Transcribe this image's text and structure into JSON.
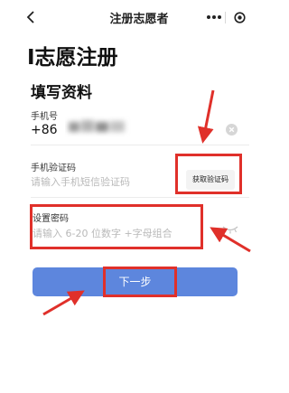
{
  "nav": {
    "title": "注册志愿者",
    "back_icon": "chevron-left-icon",
    "more_icon": "more-dots-icon",
    "close_icon": "target-circle-icon"
  },
  "main": {
    "title": "I志愿注册",
    "section_title": "填写资料"
  },
  "phone": {
    "label": "手机号",
    "prefix": "+86",
    "value_state": "blurred",
    "clear_icon": "clear-circle-icon"
  },
  "sms_code": {
    "label": "手机验证码",
    "placeholder": "请输入手机短信验证码",
    "button_label": "获取验证码"
  },
  "password": {
    "label": "设置密码",
    "placeholder": "请输入 6-20 位数字 +字母组合",
    "visibility_icon": "eye-closed-icon"
  },
  "next_button": {
    "label": "下一步"
  },
  "colors": {
    "primary_button": "#5d86dd",
    "annotation_red": "#e0302a",
    "placeholder_text": "#b9b9b9"
  }
}
